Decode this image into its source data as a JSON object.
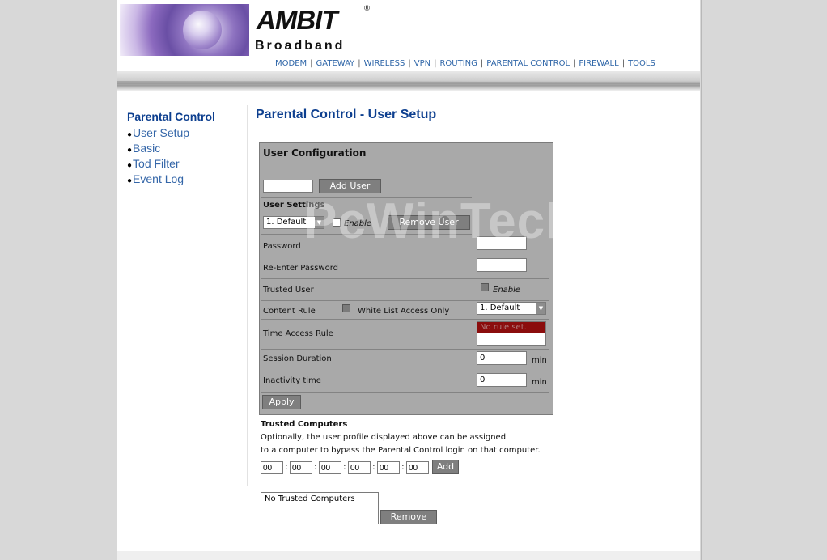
{
  "brand": {
    "name": "AMBIT",
    "registered": "®",
    "tagline": "Broadband"
  },
  "topnav": [
    "MODEM",
    "GATEWAY",
    "WIRELESS",
    "VPN",
    "ROUTING",
    "PARENTAL CONTROL",
    "FIREWALL",
    "TOOLS"
  ],
  "sidebar": {
    "title": "Parental Control",
    "items": [
      "User Setup",
      "Basic",
      "Tod Filter",
      "Event Log"
    ]
  },
  "page_title": "Parental Control - User Setup",
  "user_config": {
    "heading": "User Configuration",
    "new_user_value": "",
    "add_user_label": "Add User",
    "user_settings_label": "User Settings",
    "user_select_value": "1. Default",
    "enable_label": "Enable",
    "remove_user_label": "Remove User",
    "password_label": "Password",
    "reenter_password_label": "Re-Enter Password",
    "trusted_user_label": "Trusted User",
    "trusted_enable_label": "Enable",
    "content_rule_label": "Content Rule",
    "white_list_label": "White List Access Only",
    "content_rule_value": "1. Default",
    "time_access_rule_label": "Time Access Rule",
    "time_access_rule_value": "No rule set.",
    "session_duration_label": "Session Duration",
    "session_duration_value": "0",
    "inactivity_label": "Inactivity time",
    "inactivity_value": "0",
    "min_unit": "min",
    "apply_label": "Apply"
  },
  "trusted_computers": {
    "title": "Trusted Computers",
    "desc_line1": "Optionally, the user profile displayed above can be assigned",
    "desc_line2": "to a computer to bypass the Parental Control login on that computer.",
    "mac": [
      "00",
      "00",
      "00",
      "00",
      "00",
      "00"
    ],
    "add_label": "Add",
    "list_item": "No Trusted Computers",
    "remove_label": "Remove"
  },
  "watermark": "PcWinTech.com",
  "colors": {
    "title_blue": "#0d3f8f",
    "link_blue": "#3466a8",
    "panel_gray": "#a9a9a9",
    "button_gray": "#7f7f7f",
    "rule_red": "#8b0d0d"
  }
}
